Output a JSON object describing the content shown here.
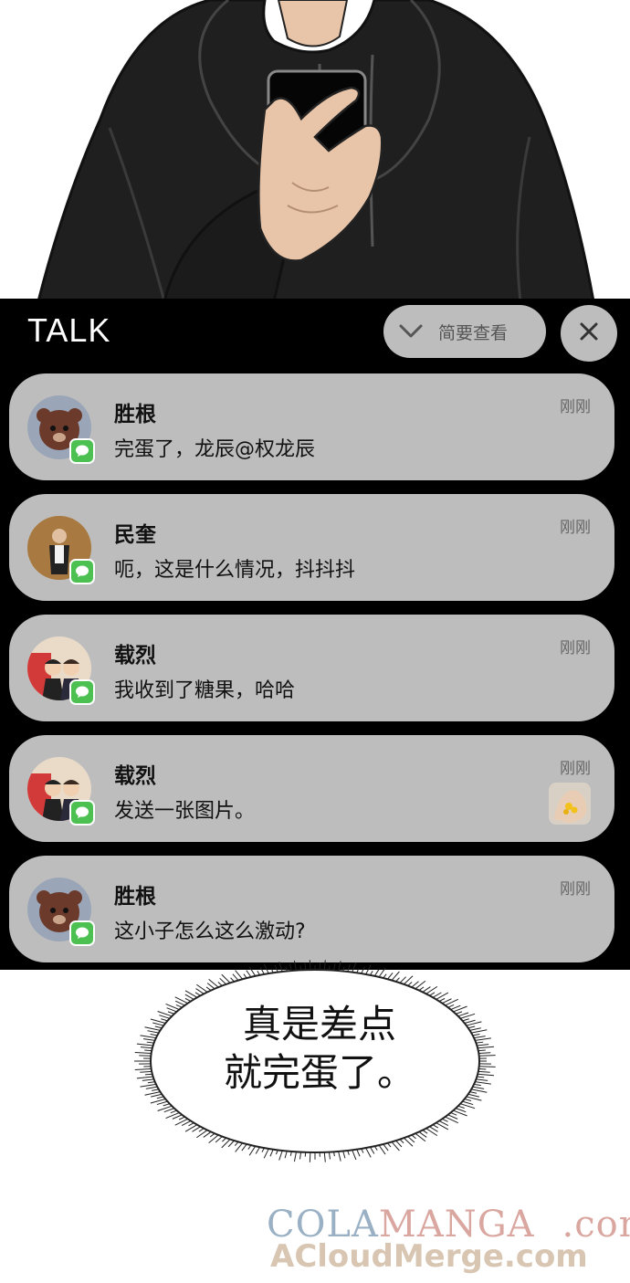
{
  "header": {
    "title": "TALK",
    "brief_view_label": "简要查看",
    "close_icon": "close-icon"
  },
  "notifications": [
    {
      "sender": "胜根",
      "message": "完蛋了，龙辰@权龙辰",
      "time": "刚刚",
      "avatar": "bear-avatar",
      "app_icon": "chat-app-icon"
    },
    {
      "sender": "民奎",
      "message": "呃，这是什么情况，抖抖抖",
      "time": "刚刚",
      "avatar": "person-avatar",
      "app_icon": "chat-app-icon"
    },
    {
      "sender": "载烈",
      "message": "我收到了糖果，哈哈",
      "time": "刚刚",
      "avatar": "faker-avatar",
      "app_icon": "chat-app-icon"
    },
    {
      "sender": "载烈",
      "message": "发送一张图片。",
      "time": "刚刚",
      "avatar": "faker-avatar",
      "app_icon": "chat-app-icon",
      "thumbnail": "candy-photo-thumbnail"
    },
    {
      "sender": "胜根",
      "message": "这小子怎么这么激动?",
      "time": "刚刚",
      "avatar": "bear-avatar",
      "app_icon": "chat-app-icon"
    }
  ],
  "bubble": {
    "line1": "真是差点",
    "line2": "就完蛋了。"
  },
  "watermark": {
    "line1_part1": "COLA",
    "line1_part2": "MANGA",
    "line1_part3": ".com",
    "line2": "ACloudMerge.com"
  },
  "colors": {
    "panel_bg": "#000000",
    "card_bg": "#bdbdbd",
    "badge_green": "#4cc152"
  }
}
